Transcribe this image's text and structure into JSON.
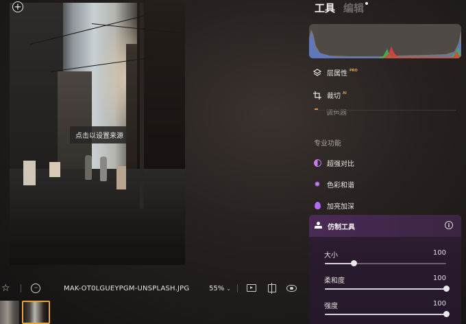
{
  "canvas": {
    "tooltip": "点击以设置来源",
    "expand_icon_glyph": "+"
  },
  "bottom_bar": {
    "star_icon": "☆",
    "more_icon": "···",
    "filename": "MAK-OT0LGUEYPGM-UNSPLASH.JPG",
    "zoom": "55%",
    "zoom_caret": "⌄"
  },
  "panel": {
    "tab_tools": "工具",
    "tab_edit": "编辑",
    "histogram_colors": {
      "blue": "#5a78c8",
      "green": "#3fb152",
      "red": "#d8443a"
    },
    "rows": {
      "layers": {
        "label": "层属性",
        "badge": "PRO",
        "icon": "layers-icon"
      },
      "crop": {
        "label": "裁切",
        "badge": "AI",
        "icon": "crop-icon"
      },
      "cut_partial": {
        "label": "调色器"
      }
    },
    "section_title": "专业功能",
    "pro_items": [
      {
        "label": "超强对比",
        "icon": "contrast-icon"
      },
      {
        "label": "色彩和谐",
        "icon": "color-harmony-icon"
      },
      {
        "label": "加亮加深",
        "icon": "dodge-burn-icon"
      }
    ],
    "clone_tool": {
      "title": "仿制工具",
      "info_glyph": "i",
      "sliders": [
        {
          "label": "大小",
          "value": "100",
          "fraction": 0.24
        },
        {
          "label": "柔和度",
          "value": "100",
          "fraction": 1.0
        },
        {
          "label": "强度",
          "value": "100",
          "fraction": 1.0
        }
      ]
    },
    "accent_color": "#c47df2"
  }
}
